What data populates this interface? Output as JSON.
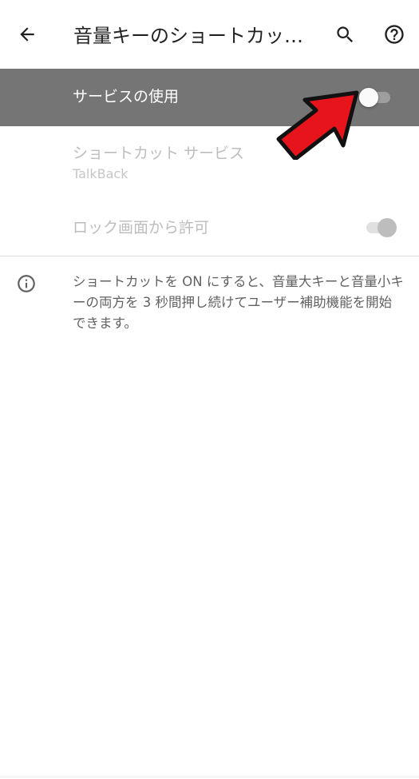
{
  "app_bar": {
    "title": "音量キーのショートカッ…",
    "back_icon": "arrow-back-icon",
    "search_icon": "search-icon",
    "help_icon": "help-circle-icon"
  },
  "settings": {
    "use_service": {
      "label": "サービスの使用",
      "toggle_on": false
    },
    "shortcut_service": {
      "label": "ショートカット サービス",
      "value": "TalkBack"
    },
    "lock_screen": {
      "label": "ロック画面から許可",
      "toggle_on": true
    }
  },
  "info": {
    "icon": "info-icon",
    "text": "ショートカットを ON にすると、音量大キーと音量小キーの両方を 3 秒間押し続けてユーザー補助機能を開始できます。"
  },
  "colors": {
    "highlight_row": "#757575",
    "arrow_fill": "#e8141c",
    "disabled_text": "#bdbdbd"
  }
}
